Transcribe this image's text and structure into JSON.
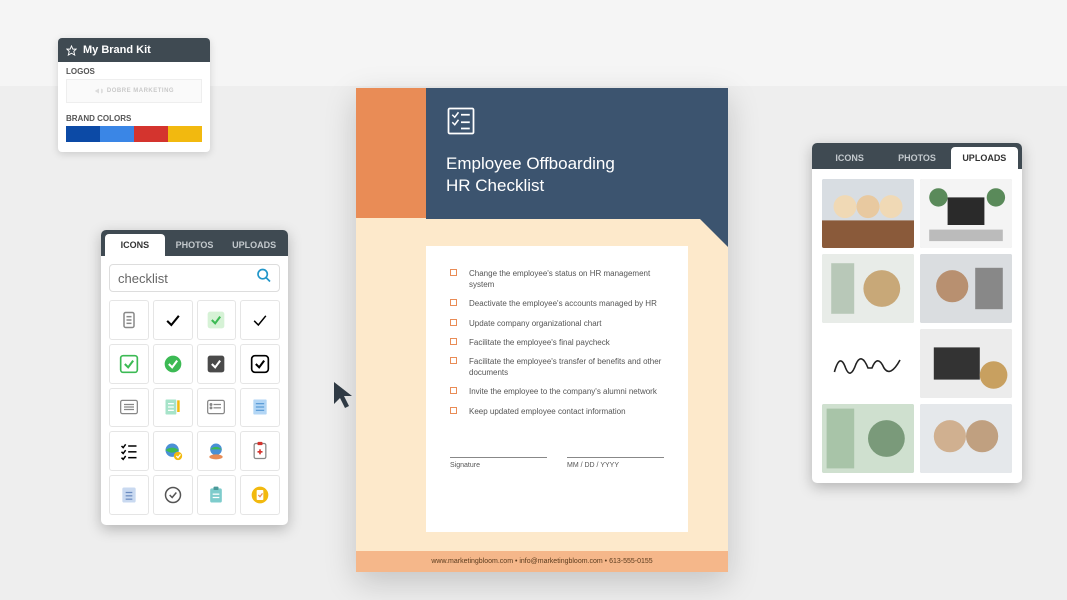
{
  "brandkit": {
    "title": "My Brand Kit",
    "logos_label": "LOGOS",
    "logo_text": "DOBRE MARKETING",
    "colors_label": "BRAND COLORS",
    "colors": [
      "#0c4aa6",
      "#3a86e6",
      "#d4342e",
      "#f2b90f"
    ]
  },
  "icons_panel": {
    "tabs": [
      "ICONS",
      "PHOTOS",
      "UPLOADS"
    ],
    "active_tab": 0,
    "search_value": "checklist"
  },
  "uploads_panel": {
    "tabs": [
      "ICONS",
      "PHOTOS",
      "UPLOADS"
    ],
    "active_tab": 2
  },
  "document": {
    "title_line1": "Employee Offboarding",
    "title_line2": "HR Checklist",
    "items": [
      "Change the employee's status on HR management system",
      "Deactivate the employee's accounts managed by HR",
      "Update company organizational chart",
      "Facilitate the employee's final paycheck",
      "Facilitate the employee's transfer of benefits and other documents",
      "Invite the employee to the company's alumni network",
      "Keep updated employee contact information"
    ],
    "signature_label": "Signature",
    "date_label": "MM / DD / YYYY",
    "footer": "www.marketingbloom.com  •  info@marketingbloom.com  •  613-555-0155"
  }
}
